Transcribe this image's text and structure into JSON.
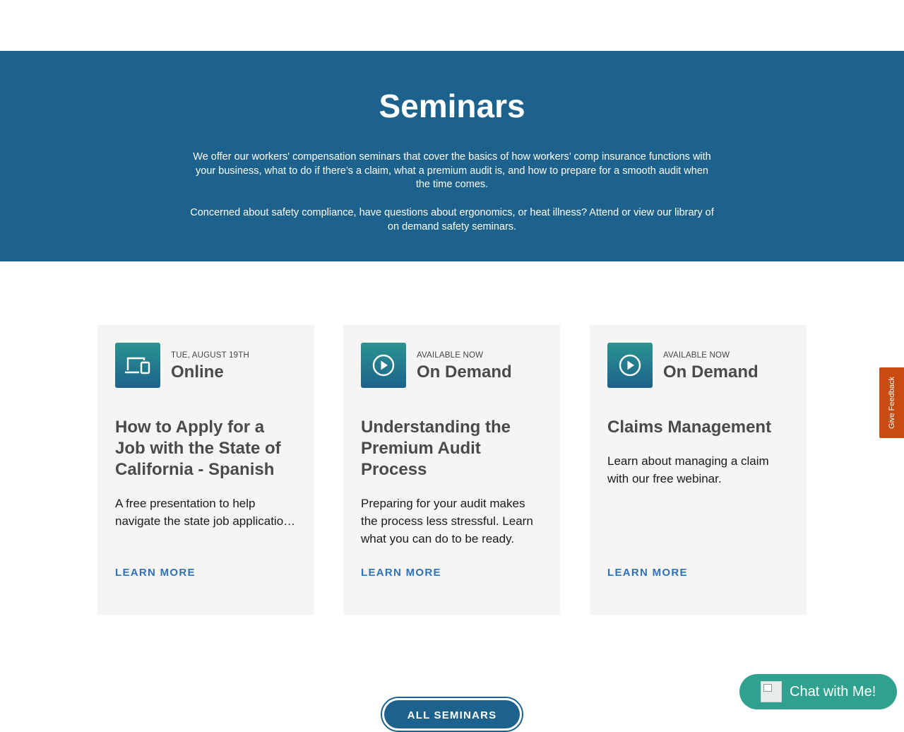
{
  "hero": {
    "title": "Seminars",
    "paragraph1": "We offer our workers' compensation seminars that cover the basics of how workers’ comp insurance functions with your business, what to do if there’s a claim, what a premium audit is, and how to prepare for a smooth audit when the time comes.",
    "paragraph2": "Concerned about safety compliance, have questions about ergonomics, or heat illness? Attend or view our library of on demand safety seminars."
  },
  "cards": [
    {
      "icon": "devices-icon",
      "eyebrow": "TUE, AUGUST 19TH",
      "mode": "Online",
      "title": "How to Apply for a Job with the State of California - Spanish",
      "description_line1": "A free presentation to help",
      "description_line2": "navigate the state job application process",
      "cta": "LEARN MORE"
    },
    {
      "icon": "play-circle-icon",
      "eyebrow": "AVAILABLE NOW",
      "mode": "On Demand",
      "title": "Understanding the Premium Audit Process",
      "description": "Preparing for your audit makes the process less stressful. Learn what you can do to be ready.",
      "cta": "LEARN MORE"
    },
    {
      "icon": "play-circle-icon",
      "eyebrow": "AVAILABLE NOW",
      "mode": "On Demand",
      "title": "Claims Management",
      "description": "Learn about managing a claim with our free webinar.",
      "cta": "LEARN MORE"
    }
  ],
  "all_seminars_label": "ALL SEMINARS",
  "feedback_label": "Give Feedback",
  "chat_label": "Chat with Me!",
  "colors": {
    "hero_bg": "#1d628c",
    "card_bg": "#f6f5f3",
    "link": "#2d72b8",
    "feedback_bg": "#c84b0f",
    "chat_bg": "#31a18f"
  }
}
